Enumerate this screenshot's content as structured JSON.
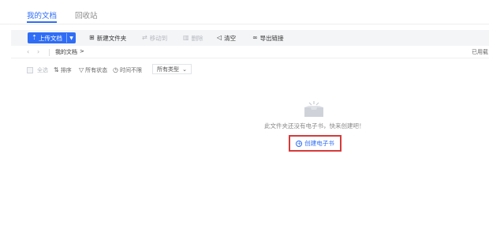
{
  "tabs": [
    {
      "label": "我的文档"
    },
    {
      "label": "回收站"
    }
  ],
  "toolbar": {
    "upload_label": "上传文档",
    "new_folder_label": "新建文件夹",
    "move_label": "移动到",
    "delete_label": "删除",
    "clear_label": "清空",
    "export_label": "导出链接"
  },
  "nav": {
    "breadcrumb": "我的文档",
    "breadcrumb_arrow": ">",
    "used_label": "已用载"
  },
  "filters": {
    "select_all": "全选",
    "sort": "排序",
    "all_status": "所有状态",
    "time_unlimited": "时间不限",
    "all_types": "所有类型"
  },
  "empty_state": {
    "message": "此文件夹还没有电子书，快来创建吧！",
    "create_label": "创建电子书"
  },
  "colors": {
    "accent": "#2f6df6",
    "highlight_border": "#d63a3a"
  }
}
